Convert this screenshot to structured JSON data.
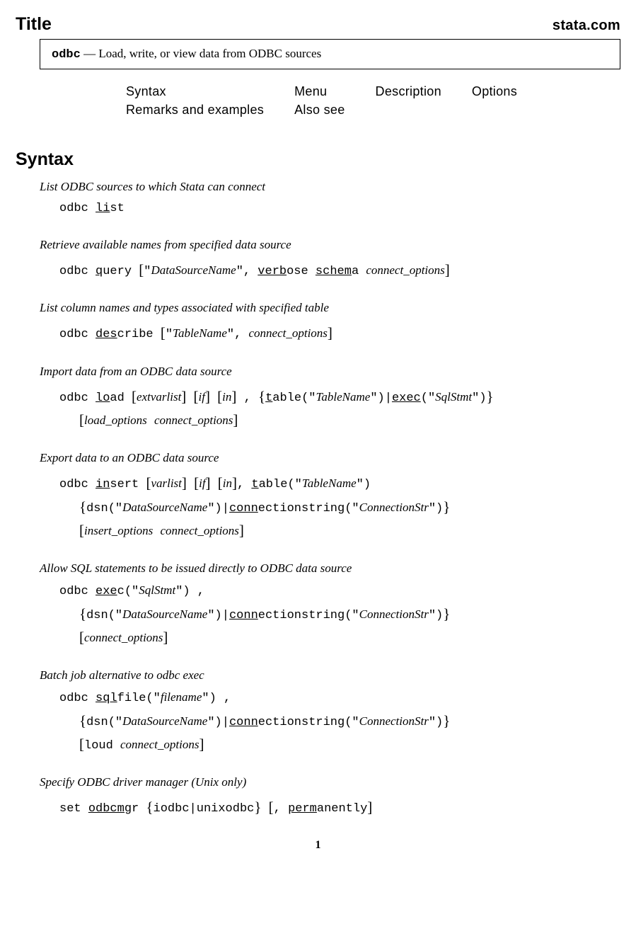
{
  "header": {
    "title": "Title",
    "site": "stata.com"
  },
  "titlebox": {
    "command": "odbc",
    "dash": " — ",
    "description": "Load, write, or view data from ODBC sources"
  },
  "nav": {
    "row1": [
      "Syntax",
      "Menu",
      "Description",
      "Options"
    ],
    "row2": [
      "Remarks and examples",
      "Also see",
      "",
      ""
    ]
  },
  "syntax": {
    "heading": "Syntax",
    "items": [
      {
        "desc": "List ODBC sources to which Stata can connect",
        "html": "odbc <span class='u'>li</span>st"
      },
      {
        "desc": "Retrieve available names from specified data source",
        "html": "odbc <span class='u'>q</span>uery <span class='lbr'>[</span>\"<span class='it'>DataSourceName</span>\", <span class='u'>verb</span>ose <span class='u'>schem</span>a <span class='it'>connect_options</span><span class='rbr'>]</span>"
      },
      {
        "desc": "List column names and types associated with specified table",
        "html": "odbc <span class='u'>des</span>cribe <span class='lbr'>[</span>\"<span class='it'>TableName</span>\", <span class='it'>connect_options</span><span class='rbr'>]</span>"
      },
      {
        "desc": "Import data from an ODBC data source",
        "html": "odbc <span class='u'>lo</span>ad <span class='lbr'>[</span><span class='it'>extvarlist</span><span class='rbr'>]</span> <span class='lbr'>[</span><span class='it'>if</span><span class='rbr'>]</span> <span class='lbr'>[</span><span class='it'>in</span><span class='rbr'>]</span> , <span class='lcb'>{</span><span class='u'>t</span>able(\"<span class='it'>TableName</span>\")|<span class='u'>exec</span>(\"<span class='it'>SqlStmt</span>\")<span class='rcb'>}</span>",
        "cont": [
          "<span class='lbr'>[</span><span class='it'>load_options</span> <span class='it'>connect_options</span><span class='rbr'>]</span>"
        ]
      },
      {
        "desc": "Export data to an ODBC data source",
        "html": "odbc <span class='u'>in</span>sert <span class='lbr'>[</span><span class='it'>varlist</span><span class='rbr'>]</span> <span class='lbr'>[</span><span class='it'>if</span><span class='rbr'>]</span> <span class='lbr'>[</span><span class='it'>in</span><span class='rbr'>]</span>, <span class='u'>t</span>able(\"<span class='it'>TableName</span>\")",
        "cont": [
          "<span class='lcb'>{</span>dsn(\"<span class='it'>DataSourceName</span>\")|<span class='u'>conn</span>ectionstring(\"<span class='it'>ConnectionStr</span>\")<span class='rcb'>}</span>",
          "<span class='lbr'>[</span><span class='it'>insert_options</span> <span class='it'>connect_options</span><span class='rbr'>]</span>"
        ]
      },
      {
        "desc": "Allow SQL statements to be issued directly to ODBC data source",
        "html": "odbc <span class='u'>exe</span>c(\"<span class='it'>SqlStmt</span>\") ,",
        "cont": [
          "<span class='lcb'>{</span>dsn(\"<span class='it'>DataSourceName</span>\")|<span class='u'>conn</span>ectionstring(\"<span class='it'>ConnectionStr</span>\")<span class='rcb'>}</span>",
          "<span class='lbr'>[</span><span class='it'>connect_options</span><span class='rbr'>]</span>"
        ]
      },
      {
        "desc": "Batch job alternative to odbc exec",
        "html": "odbc <span class='u'>sql</span>file(\"<span class='it'>filename</span>\") ,",
        "cont": [
          "<span class='lcb'>{</span>dsn(\"<span class='it'>DataSourceName</span>\")|<span class='u'>conn</span>ectionstring(\"<span class='it'>ConnectionStr</span>\")<span class='rcb'>}</span>",
          "<span class='lbr'>[</span>loud <span class='it'>connect_options</span><span class='rbr'>]</span>"
        ]
      },
      {
        "desc": "Specify ODBC driver manager (Unix only)",
        "html": "set <span class='u'>odbcmg</span>r <span class='lcb'>{</span>iodbc|unixodbc<span class='rcb'>}</span> <span class='lbr'>[</span>, <span class='u'>perm</span>anently<span class='rbr'>]</span>"
      }
    ]
  },
  "pagenum": "1"
}
